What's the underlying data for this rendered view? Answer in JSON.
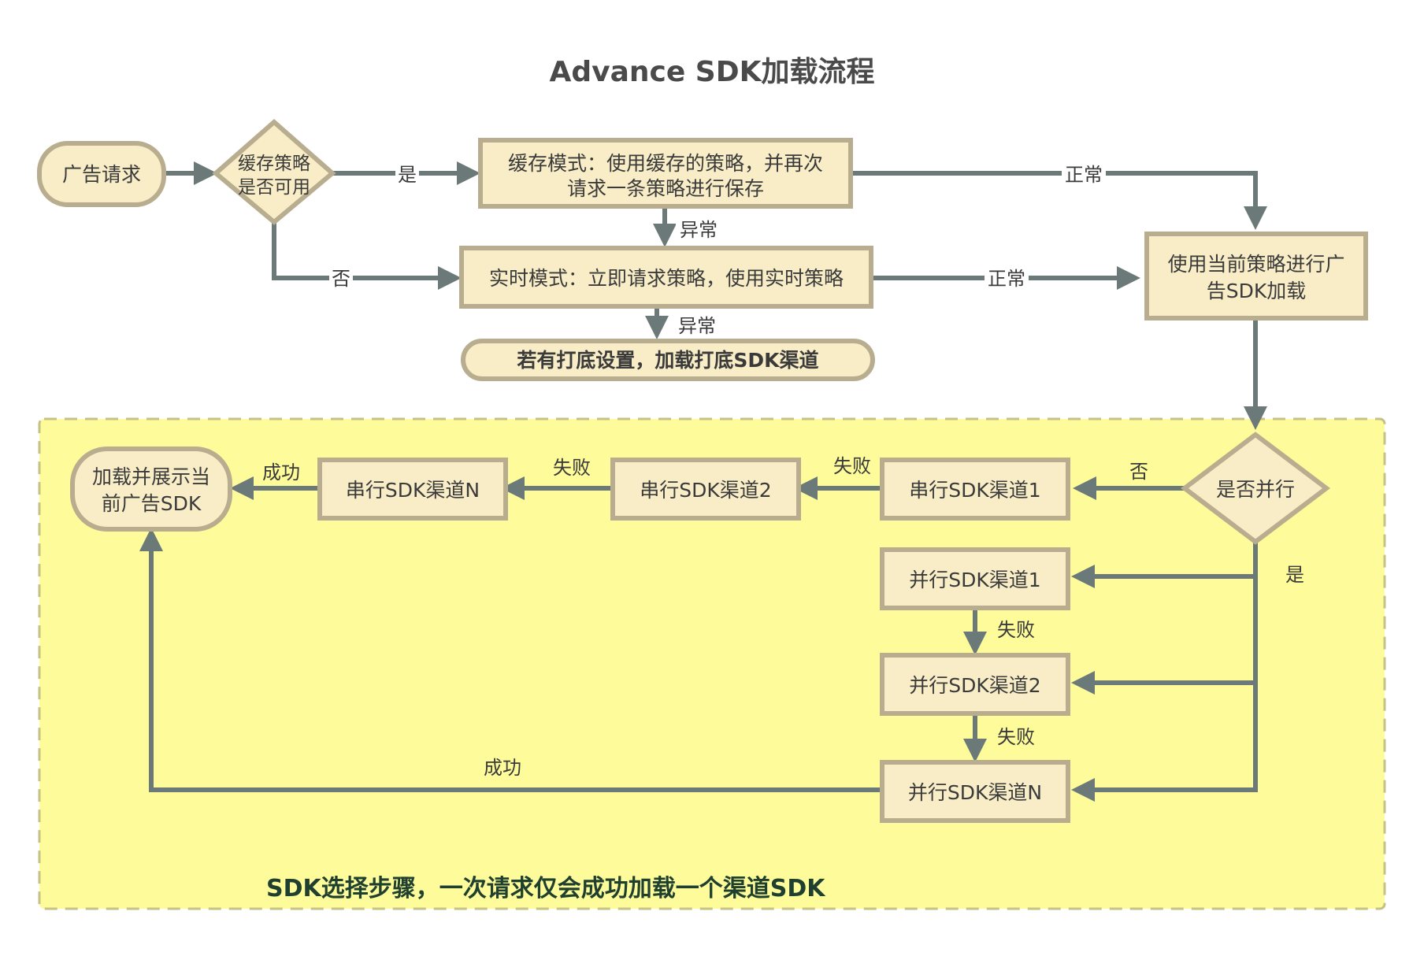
{
  "title": "Advance SDK加载流程",
  "nodes": {
    "ad_request": "广告请求",
    "cache_check_l1": "缓存策略",
    "cache_check_l2": "是否可用",
    "cache_mode_l1": "缓存模式：使用缓存的策略，并再次",
    "cache_mode_l2": "请求一条策略进行保存",
    "realtime_mode": "实时模式：立即请求策略，使用实时策略",
    "fallback": "若有打底设置，加载打底SDK渠道",
    "use_strategy_l1": "使用当前策略进行广",
    "use_strategy_l2": "告SDK加载",
    "parallel_check": "是否并行",
    "serial_1": "串行SDK渠道1",
    "serial_2": "串行SDK渠道2",
    "serial_n": "串行SDK渠道N",
    "show_ad_l1": "加载并展示当",
    "show_ad_l2": "前广告SDK",
    "parallel_1": "并行SDK渠道1",
    "parallel_2": "并行SDK渠道2",
    "parallel_n": "并行SDK渠道N"
  },
  "edge_labels": {
    "yes_cache": "是",
    "no_cache": "否",
    "abnormal_1": "异常",
    "abnormal_2": "异常",
    "normal_1": "正常",
    "normal_2": "正常",
    "no_parallel": "否",
    "yes_parallel": "是",
    "fail_s1": "失败",
    "fail_s2": "失败",
    "success_s": "成功",
    "fail_p1": "失败",
    "fail_p2": "失败",
    "success_p": "成功"
  },
  "group_caption": "SDK选择步骤，一次请求仅会成功加载一个渠道SDK",
  "colors": {
    "node_fill": "#f8edc7",
    "node_stroke": "#b8ad8e",
    "edge": "#6b7a78",
    "group_fill": "#fefb9a",
    "group_stroke": "#c6c186",
    "caption": "#1f3f2f"
  }
}
